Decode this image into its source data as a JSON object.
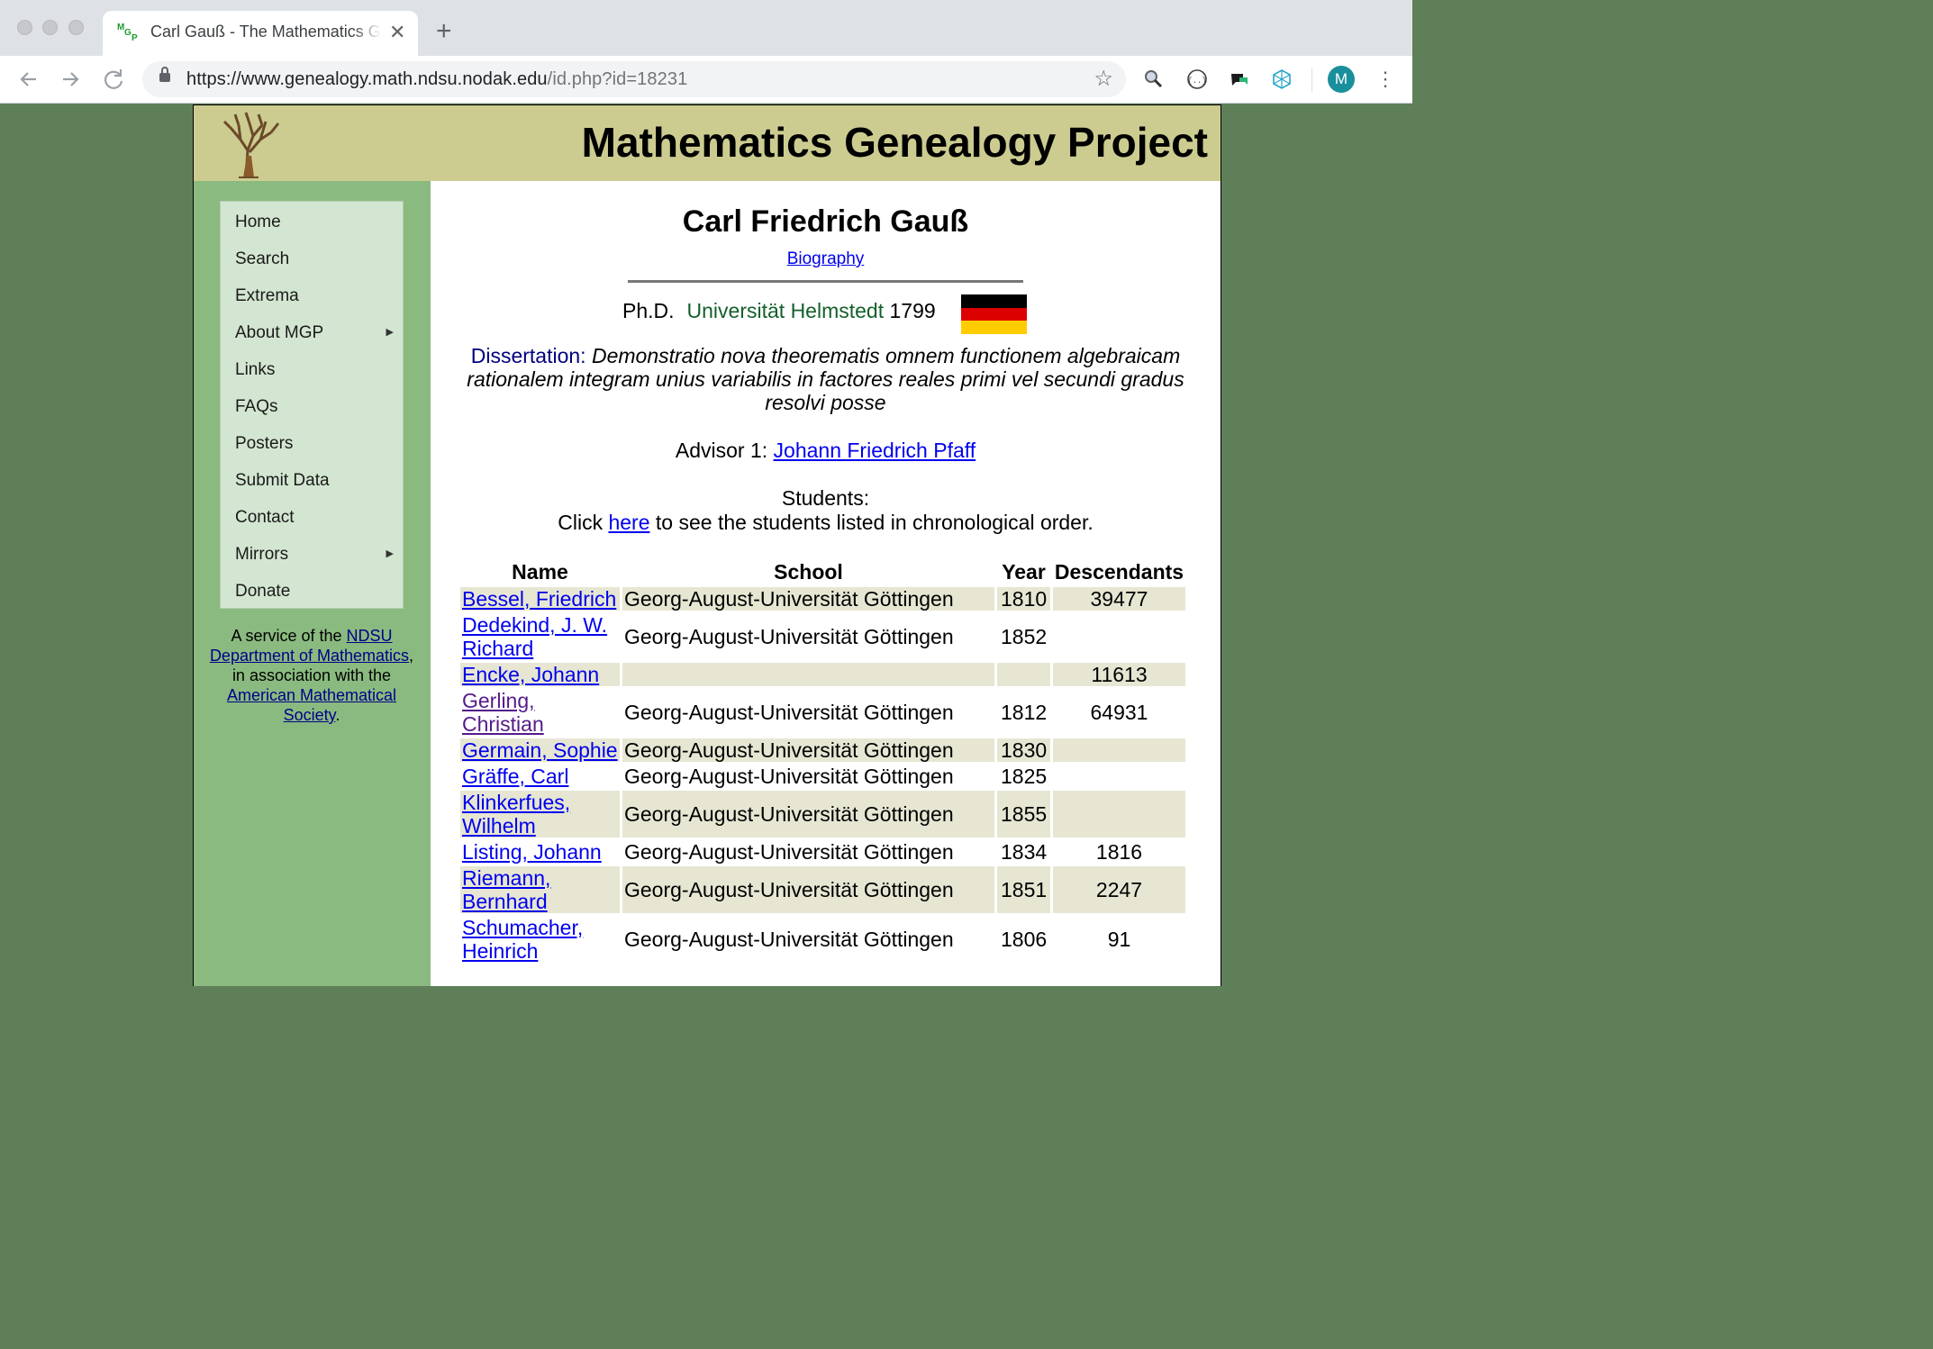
{
  "browser": {
    "tab_title": "Carl Gauß - The Mathematics Genealogy Project",
    "url_main": "https://www.genealogy.math.ndsu.nodak.edu",
    "url_path": "/id.php?id=18231",
    "avatar_letter": "M",
    "favicon_letters": [
      "M",
      "G",
      "P"
    ]
  },
  "site": {
    "title": "Mathematics Genealogy Project"
  },
  "sidebar": {
    "items": [
      {
        "label": "Home",
        "has_submenu": false
      },
      {
        "label": "Search",
        "has_submenu": false
      },
      {
        "label": "Extrema",
        "has_submenu": false
      },
      {
        "label": "About MGP",
        "has_submenu": true
      },
      {
        "label": "Links",
        "has_submenu": false
      },
      {
        "label": "FAQs",
        "has_submenu": false
      },
      {
        "label": "Posters",
        "has_submenu": false
      },
      {
        "label": "Submit Data",
        "has_submenu": false
      },
      {
        "label": "Contact",
        "has_submenu": false
      },
      {
        "label": "Mirrors",
        "has_submenu": true
      },
      {
        "label": "Donate",
        "has_submenu": false
      }
    ],
    "service": {
      "text_1": "A service of the ",
      "link_ndsu": "NDSU Department of Mathematics",
      "text_2": ", in association with the ",
      "link_ams": "American Mathematical Society",
      "text_3": "."
    }
  },
  "person": {
    "name": "Carl Friedrich Gauß",
    "biography_link": "Biography",
    "degree": "Ph.D.",
    "school": "Universität Helmstedt",
    "year": "1799",
    "flag_colors": [
      "#000000",
      "#dd0000",
      "#ffcc00"
    ],
    "dissertation_label": "Dissertation:",
    "dissertation_title": "Demonstratio nova theorematis omnem functionem algebraicam rationalem integram unius variabilis in factores reales primi vel secundi gradus resolvi posse",
    "advisor_label": "Advisor 1:",
    "advisor_name": "Johann Friedrich Pfaff"
  },
  "students": {
    "heading": "Students:",
    "click_before": "Click ",
    "click_link": "here",
    "click_after": " to see the students listed in chronological order.",
    "columns": [
      "Name",
      "School",
      "Year",
      "Descendants"
    ],
    "rows": [
      {
        "name": "Bessel, Friedrich",
        "school": "Georg-August-Universität Göttingen",
        "year": "1810",
        "descendants": "39477",
        "visited": false
      },
      {
        "name": "Dedekind, J. W. Richard",
        "school": "Georg-August-Universität Göttingen",
        "year": "1852",
        "descendants": "",
        "visited": false
      },
      {
        "name": "Encke, Johann",
        "school": "",
        "year": "",
        "descendants": "11613",
        "visited": false
      },
      {
        "name": "Gerling, Christian",
        "school": "Georg-August-Universität Göttingen",
        "year": "1812",
        "descendants": "64931",
        "visited": true
      },
      {
        "name": "Germain, Sophie",
        "school": "Georg-August-Universität Göttingen",
        "year": "1830",
        "descendants": "",
        "visited": false
      },
      {
        "name": "Gräffe, Carl",
        "school": "Georg-August-Universität Göttingen",
        "year": "1825",
        "descendants": "",
        "visited": false
      },
      {
        "name": "Klinkerfues, Wilhelm",
        "school": "Georg-August-Universität Göttingen",
        "year": "1855",
        "descendants": "",
        "visited": false
      },
      {
        "name": "Listing, Johann",
        "school": "Georg-August-Universität Göttingen",
        "year": "1834",
        "descendants": "1816",
        "visited": false
      },
      {
        "name": "Riemann, Bernhard",
        "school": "Georg-August-Universität Göttingen",
        "year": "1851",
        "descendants": "2247",
        "visited": false
      },
      {
        "name": "Schumacher, Heinrich",
        "school": "Georg-August-Universität Göttingen",
        "year": "1806",
        "descendants": "91",
        "visited": false
      }
    ]
  },
  "icons": {
    "back": "arrow-left-icon",
    "forward": "arrow-right-icon",
    "reload": "reload-icon",
    "lock": "lock-icon",
    "bookmark": "star-icon",
    "menu": "more-vertical-icon"
  }
}
